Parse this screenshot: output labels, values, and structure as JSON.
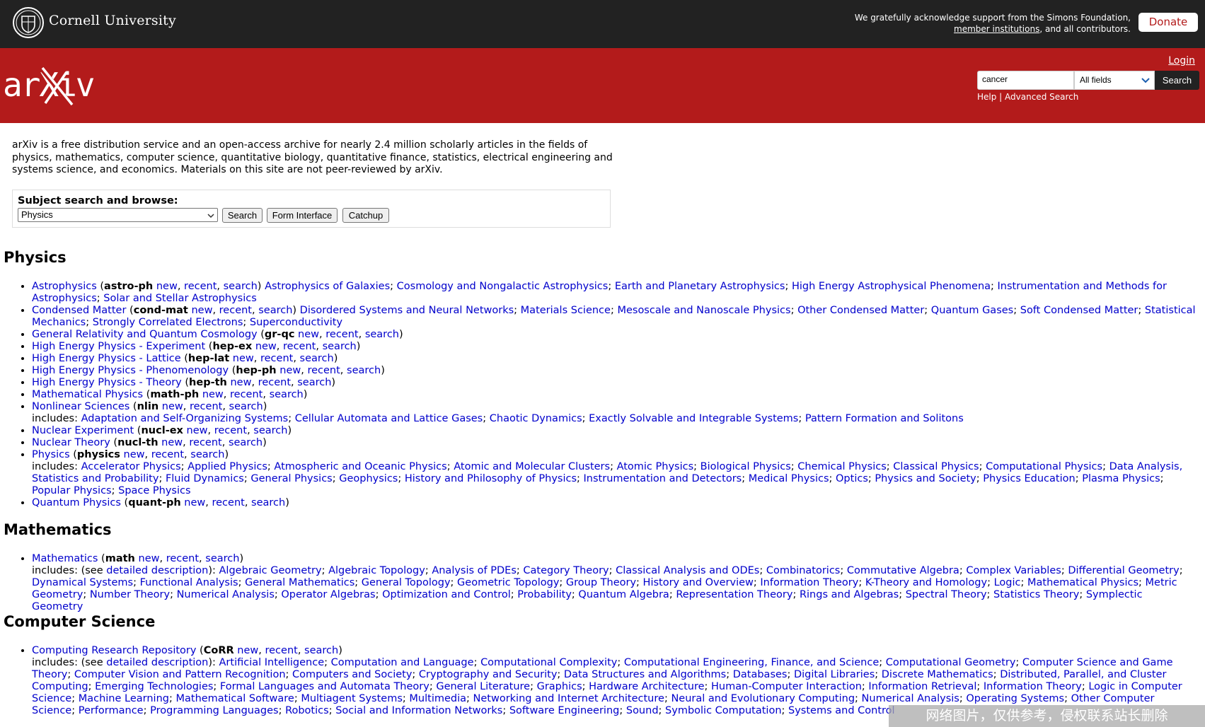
{
  "top": {
    "university": "Cornell University",
    "ack_line1": "We gratefully acknowledge support from the Simons Foundation,",
    "ack_link": "member institutions",
    "ack_rest": ", and all contributors.",
    "donate": "Donate"
  },
  "header": {
    "logo_text": "arXiv",
    "login": "Login",
    "query": "cancer",
    "field": "All fields",
    "search": "Search",
    "help": "Help",
    "sep": " | ",
    "advanced": "Advanced Search"
  },
  "intro": "arXiv is a free distribution service and an open-access archive for nearly 2.4 million scholarly articles in the fields of physics, mathematics, computer science, quantitative biology, quantitative finance, statistics, electrical engineering and systems science, and economics. Materials on this site are not peer-reviewed by arXiv.",
  "subject": {
    "label": "Subject search and browse:",
    "selected": "Physics",
    "search": "Search",
    "form": "Form Interface",
    "catchup": "Catchup"
  },
  "sections": [
    {
      "title": "Physics",
      "items": [
        {
          "name": "Astrophysics",
          "code": "astro-ph",
          "prefix": "",
          "subs": [
            "Astrophysics of Galaxies",
            "Cosmology and Nongalactic Astrophysics",
            "Earth and Planetary Astrophysics",
            "High Energy Astrophysical Phenomena",
            "Instrumentation and Methods for Astrophysics",
            "Solar and Stellar Astrophysics"
          ]
        },
        {
          "name": "Condensed Matter",
          "code": "cond-mat",
          "prefix": "",
          "subs": [
            "Disordered Systems and Neural Networks",
            "Materials Science",
            "Mesoscale and Nanoscale Physics",
            "Other Condensed Matter",
            "Quantum Gases",
            "Soft Condensed Matter",
            "Statistical Mechanics",
            "Strongly Correlated Electrons",
            "Superconductivity"
          ]
        },
        {
          "name": "General Relativity and Quantum Cosmology",
          "code": "gr-qc",
          "prefix": "",
          "subs": []
        },
        {
          "name": "High Energy Physics - Experiment",
          "code": "hep-ex",
          "prefix": "",
          "subs": []
        },
        {
          "name": "High Energy Physics - Lattice",
          "code": "hep-lat",
          "prefix": "",
          "subs": []
        },
        {
          "name": "High Energy Physics - Phenomenology",
          "code": "hep-ph",
          "prefix": "",
          "subs": []
        },
        {
          "name": "High Energy Physics - Theory",
          "code": "hep-th",
          "prefix": "",
          "subs": []
        },
        {
          "name": "Mathematical Physics",
          "code": "math-ph",
          "prefix": "",
          "subs": []
        },
        {
          "name": "Nonlinear Sciences",
          "code": "nlin",
          "prefix": "includes: ",
          "subs": [
            "Adaptation and Self-Organizing Systems",
            "Cellular Automata and Lattice Gases",
            "Chaotic Dynamics",
            "Exactly Solvable and Integrable Systems",
            "Pattern Formation and Solitons"
          ]
        },
        {
          "name": "Nuclear Experiment",
          "code": "nucl-ex",
          "prefix": "",
          "subs": []
        },
        {
          "name": "Nuclear Theory",
          "code": "nucl-th",
          "prefix": "",
          "subs": []
        },
        {
          "name": "Physics",
          "code": "physics",
          "prefix": "includes: ",
          "subs": [
            "Accelerator Physics",
            "Applied Physics",
            "Atmospheric and Oceanic Physics",
            "Atomic and Molecular Clusters",
            "Atomic Physics",
            "Biological Physics",
            "Chemical Physics",
            "Classical Physics",
            "Computational Physics",
            "Data Analysis, Statistics and Probability",
            "Fluid Dynamics",
            "General Physics",
            "Geophysics",
            "History and Philosophy of Physics",
            "Instrumentation and Detectors",
            "Medical Physics",
            "Optics",
            "Physics and Society",
            "Physics Education",
            "Plasma Physics",
            "Popular Physics",
            "Space Physics"
          ]
        },
        {
          "name": "Quantum Physics",
          "code": "quant-ph",
          "prefix": "",
          "subs": []
        }
      ]
    },
    {
      "title": "Mathematics",
      "items": [
        {
          "name": "Mathematics",
          "code": "math",
          "prefix": "includes: (see ",
          "detail": "detailed description",
          "subs": [
            "Algebraic Geometry",
            "Algebraic Topology",
            "Analysis of PDEs",
            "Category Theory",
            "Classical Analysis and ODEs",
            "Combinatorics",
            "Commutative Algebra",
            "Complex Variables",
            "Differential Geometry",
            "Dynamical Systems",
            "Functional Analysis",
            "General Mathematics",
            "General Topology",
            "Geometric Topology",
            "Group Theory",
            "History and Overview",
            "Information Theory",
            "K-Theory and Homology",
            "Logic",
            "Mathematical Physics",
            "Metric Geometry",
            "Number Theory",
            "Numerical Analysis",
            "Operator Algebras",
            "Optimization and Control",
            "Probability",
            "Quantum Algebra",
            "Representation Theory",
            "Rings and Algebras",
            "Spectral Theory",
            "Statistics Theory",
            "Symplectic Geometry"
          ]
        }
      ]
    },
    {
      "title": "Computer Science",
      "items": [
        {
          "name": "Computing Research Repository",
          "code": "CoRR",
          "prefix": "includes: (see ",
          "detail": "detailed description",
          "subs": [
            "Artificial Intelligence",
            "Computation and Language",
            "Computational Complexity",
            "Computational Engineering, Finance, and Science",
            "Computational Geometry",
            "Computer Science and Game Theory",
            "Computer Vision and Pattern Recognition",
            "Computers and Society",
            "Cryptography and Security",
            "Data Structures and Algorithms",
            "Databases",
            "Digital Libraries",
            "Discrete Mathematics",
            "Distributed, Parallel, and Cluster Computing",
            "Emerging Technologies",
            "Formal Languages and Automata Theory",
            "General Literature",
            "Graphics",
            "Hardware Architecture",
            "Human-Computer Interaction",
            "Information Retrieval",
            "Information Theory",
            "Logic in Computer Science",
            "Machine Learning",
            "Mathematical Software",
            "Multiagent Systems",
            "Multimedia",
            "Networking and Internet Architecture",
            "Neural and Evolutionary Computing",
            "Numerical Analysis",
            "Operating Systems",
            "Other Computer Science",
            "Performance",
            "Programming Languages",
            "Robotics",
            "Social and Information Networks",
            "Software Engineering",
            "Sound",
            "Symbolic Computation",
            "Systems and Control"
          ]
        }
      ]
    }
  ],
  "links": {
    "new": "new",
    "recent": "recent",
    "search": "search"
  },
  "colors": {
    "header_red": "#b31b1b",
    "topbar": "#222222",
    "link": "#0000cc"
  },
  "watermark": "网络图片，仅供参考，侵权联系站长删除"
}
